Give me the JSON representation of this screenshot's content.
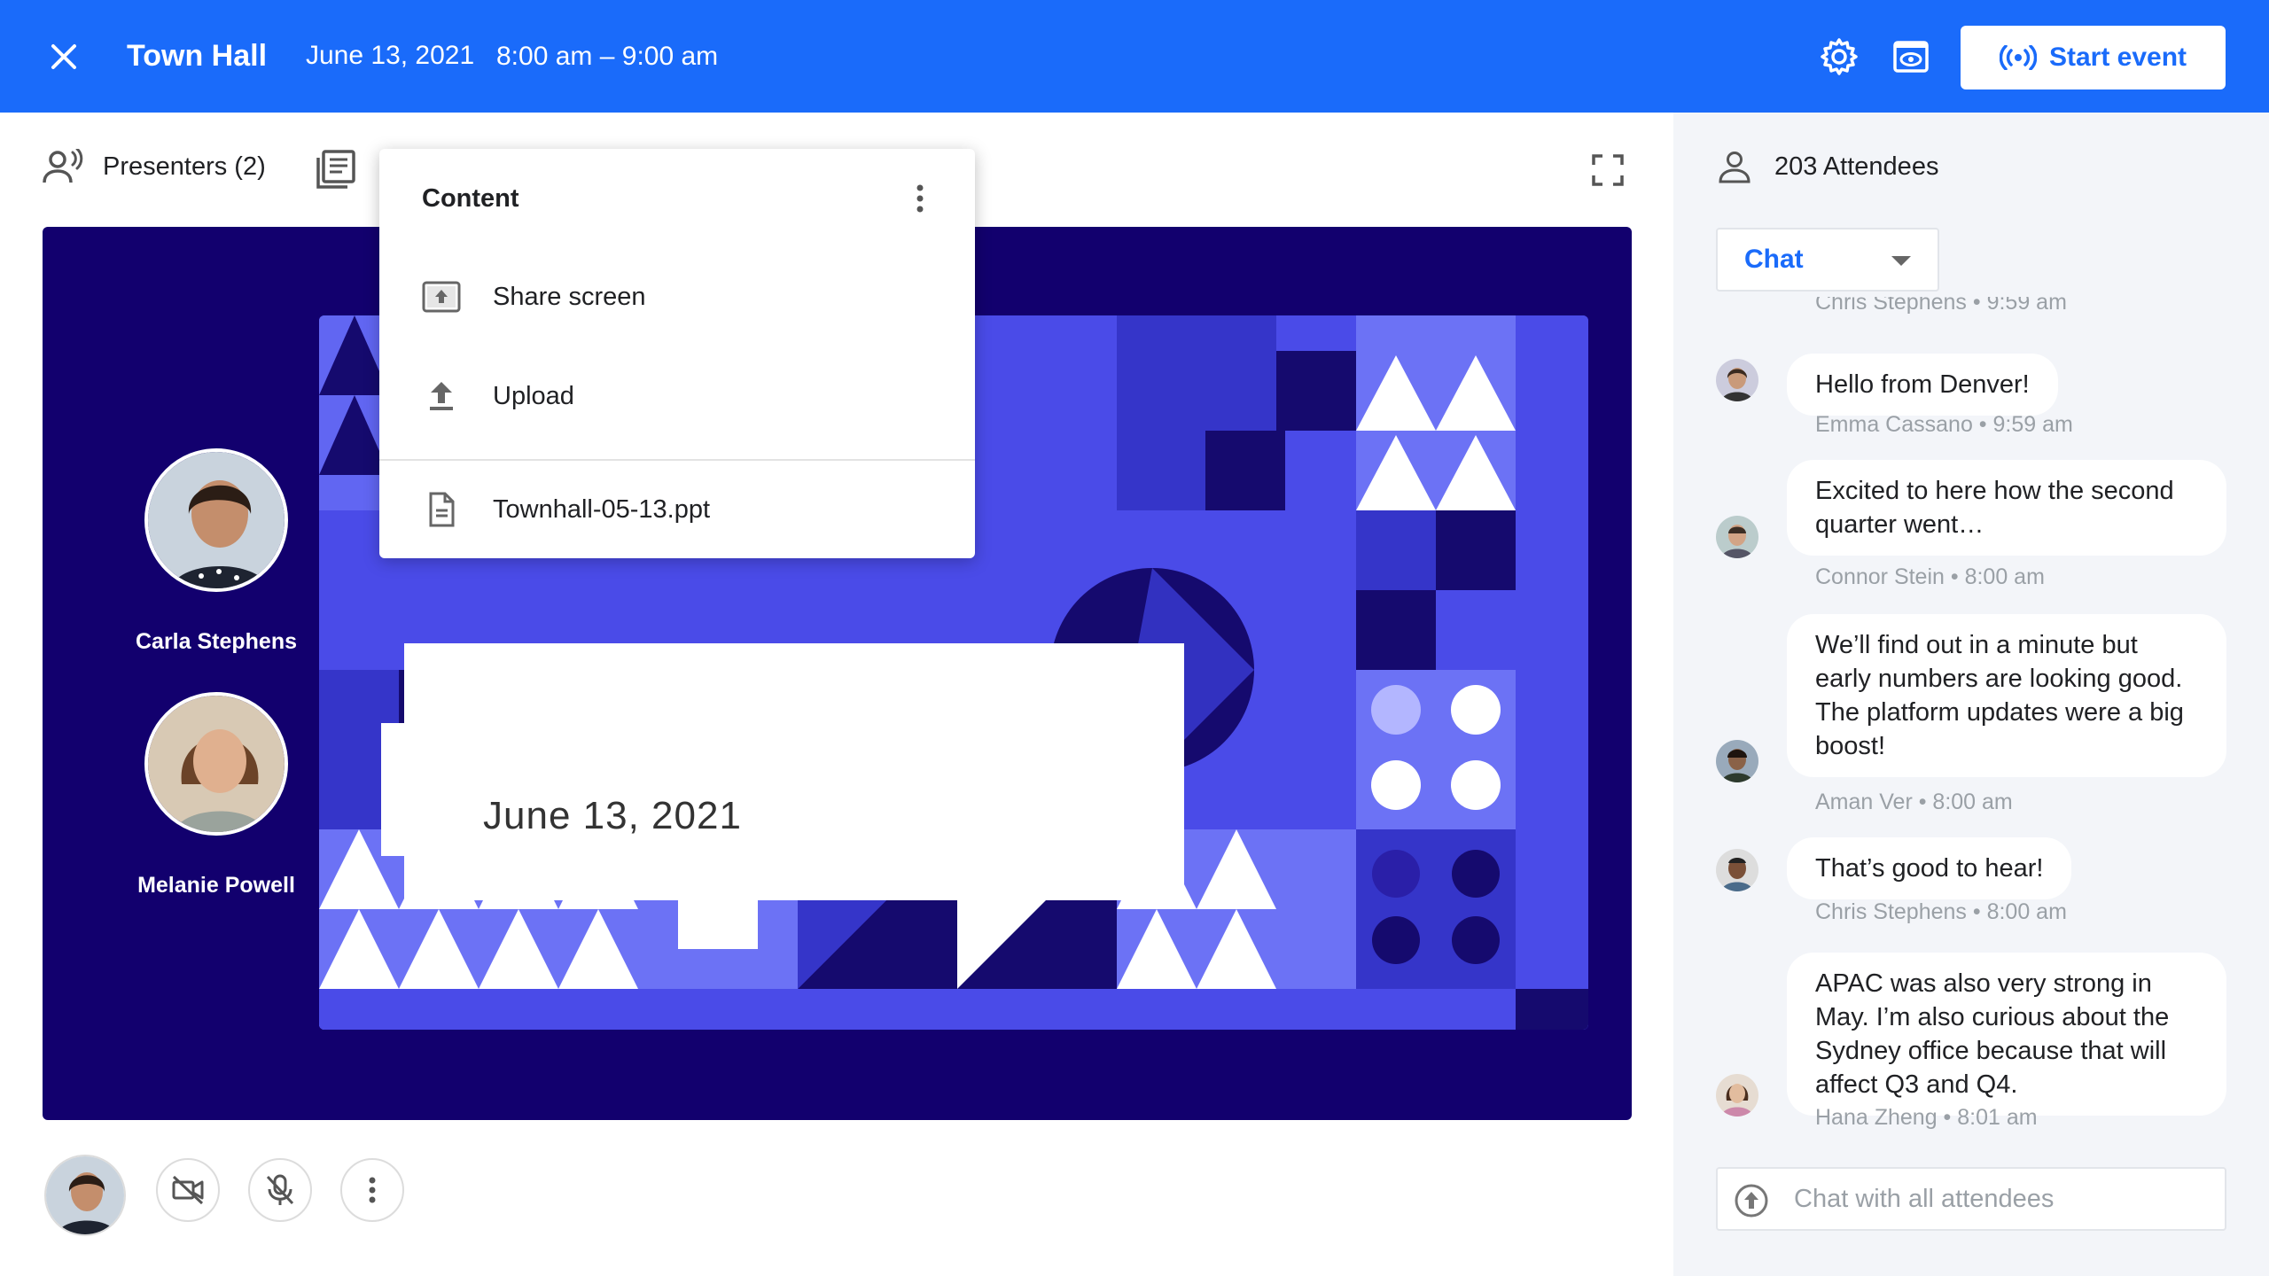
{
  "header": {
    "title": "Town Hall",
    "date": "June 13, 2021",
    "time": "8:00 am – 9:00 am",
    "start_label": "Start event",
    "icons": [
      "close-icon",
      "gear-icon",
      "preview-icon",
      "broadcast-icon"
    ]
  },
  "toolbar": {
    "presenters_label": "Presenters (2)"
  },
  "presenters": [
    {
      "name": "Carla Stephens"
    },
    {
      "name": "Melanie Powell"
    }
  ],
  "slide": {
    "date": "June 13, 2021"
  },
  "content_menu": {
    "title": "Content",
    "items": [
      {
        "label": "Share screen",
        "icon": "share-screen-icon"
      },
      {
        "label": "Upload",
        "icon": "upload-icon"
      },
      {
        "label": "Townhall-05-13.ppt",
        "icon": "document-icon"
      }
    ]
  },
  "panel": {
    "attendees_label": "203 Attendees",
    "chat_select": "Chat",
    "input_placeholder": "Chat with all attendees"
  },
  "chat": [
    {
      "meta": "Chris Stephens • 9:59 am"
    },
    {
      "text": "Hello from Denver!",
      "meta": "Emma Cassano • 9:59 am"
    },
    {
      "text": "Excited to here how the second quarter went…",
      "meta": "Connor Stein • 8:00 am"
    },
    {
      "text": "We’ll find out in a minute but early numbers are looking good. The platform updates were a big boost!",
      "meta": "Aman Ver • 8:00 am"
    },
    {
      "text": "That’s good to hear!",
      "meta": "Chris Stephens • 8:00 am"
    },
    {
      "text": "APAC was also very strong in May. I’m also curious about the Sydney office because that will affect Q3 and Q4.",
      "meta": "Hana Zheng • 8:01 am"
    }
  ],
  "colors": {
    "brand": "#1a6bfa",
    "stage": "#12006e",
    "slide_mid": "#4a4be8",
    "panel_bg": "#f3f5f9"
  }
}
